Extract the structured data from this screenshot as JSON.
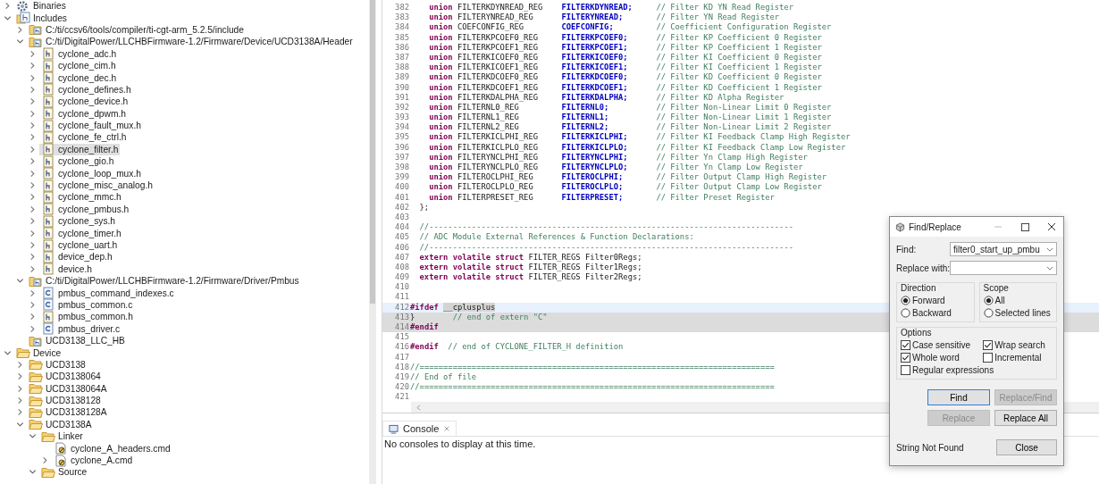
{
  "project_tree": [
    {
      "label": "Binaries",
      "kind": "binaries",
      "expanded": false,
      "selected": false
    },
    {
      "label": "Includes",
      "kind": "includes",
      "expanded": true,
      "selected": false,
      "children": [
        {
          "label": "C:/ti/ccsv6/tools/compiler/ti-cgt-arm_5.2.5/include",
          "kind": "include-folder",
          "expanded": false,
          "selected": false
        },
        {
          "label": "C:/ti/DigitalPower/LLCHBFirmware-1.2/Firmware/Device/UCD3138A/Header",
          "kind": "include-folder",
          "expanded": true,
          "selected": false,
          "children": [
            {
              "label": "cyclone_adc.h",
              "kind": "header",
              "expanded": false,
              "selected": false
            },
            {
              "label": "cyclone_cim.h",
              "kind": "header",
              "expanded": false,
              "selected": false
            },
            {
              "label": "cyclone_dec.h",
              "kind": "header",
              "expanded": false,
              "selected": false
            },
            {
              "label": "cyclone_defines.h",
              "kind": "header",
              "expanded": false,
              "selected": false
            },
            {
              "label": "cyclone_device.h",
              "kind": "header",
              "expanded": false,
              "selected": false
            },
            {
              "label": "cyclone_dpwm.h",
              "kind": "header",
              "expanded": false,
              "selected": false
            },
            {
              "label": "cyclone_fault_mux.h",
              "kind": "header",
              "expanded": false,
              "selected": false
            },
            {
              "label": "cyclone_fe_ctrl.h",
              "kind": "header",
              "expanded": false,
              "selected": false
            },
            {
              "label": "cyclone_filter.h",
              "kind": "header",
              "expanded": false,
              "selected": true
            },
            {
              "label": "cyclone_gio.h",
              "kind": "header",
              "expanded": false,
              "selected": false
            },
            {
              "label": "cyclone_loop_mux.h",
              "kind": "header",
              "expanded": false,
              "selected": false
            },
            {
              "label": "cyclone_misc_analog.h",
              "kind": "header",
              "expanded": false,
              "selected": false
            },
            {
              "label": "cyclone_mmc.h",
              "kind": "header",
              "expanded": false,
              "selected": false
            },
            {
              "label": "cyclone_pmbus.h",
              "kind": "header",
              "expanded": false,
              "selected": false
            },
            {
              "label": "cyclone_sys.h",
              "kind": "header",
              "expanded": false,
              "selected": false
            },
            {
              "label": "cyclone_timer.h",
              "kind": "header",
              "expanded": false,
              "selected": false
            },
            {
              "label": "cyclone_uart.h",
              "kind": "header",
              "expanded": false,
              "selected": false
            },
            {
              "label": "device_dep.h",
              "kind": "header",
              "expanded": false,
              "selected": false
            },
            {
              "label": "device.h",
              "kind": "header",
              "expanded": false,
              "selected": false
            }
          ]
        },
        {
          "label": "C:/ti/DigitalPower/LLCHBFirmware-1.2/Firmware/Driver/Pmbus",
          "kind": "include-folder",
          "expanded": true,
          "selected": false,
          "children": [
            {
              "label": "pmbus_command_indexes.c",
              "kind": "source",
              "expanded": false,
              "selected": false
            },
            {
              "label": "pmbus_common.c",
              "kind": "source",
              "expanded": false,
              "selected": false
            },
            {
              "label": "pmbus_common.h",
              "kind": "header",
              "expanded": false,
              "selected": false
            },
            {
              "label": "pmbus_driver.c",
              "kind": "source",
              "expanded": false,
              "selected": false
            }
          ]
        },
        {
          "label": "UCD3138_LLC_HB",
          "kind": "include-folder",
          "selected": false
        }
      ]
    },
    {
      "label": "Device",
      "kind": "folder",
      "expanded": true,
      "selected": false,
      "children": [
        {
          "label": "UCD3138",
          "kind": "folder",
          "expanded": false,
          "selected": false
        },
        {
          "label": "UCD3138064",
          "kind": "folder",
          "expanded": false,
          "selected": false
        },
        {
          "label": "UCD3138064A",
          "kind": "folder",
          "expanded": false,
          "selected": false
        },
        {
          "label": "UCD3138128",
          "kind": "folder",
          "expanded": false,
          "selected": false
        },
        {
          "label": "UCD3138128A",
          "kind": "folder",
          "expanded": false,
          "selected": false
        },
        {
          "label": "UCD3138A",
          "kind": "folder",
          "expanded": true,
          "selected": false,
          "children": [
            {
              "label": "Linker",
              "kind": "folder",
              "expanded": true,
              "selected": false,
              "children": [
                {
                  "label": "cyclone_A_headers.cmd",
                  "kind": "linker",
                  "selected": false
                },
                {
                  "label": "cyclone_A.cmd",
                  "kind": "linker",
                  "expanded": false,
                  "selected": false
                }
              ]
            },
            {
              "label": "Source",
              "kind": "folder",
              "expanded": true,
              "selected": false
            }
          ]
        }
      ]
    }
  ],
  "editor": {
    "lines": [
      {
        "number": "382",
        "kind": "member",
        "keyword": "union",
        "type": "FILTERKDYNREAD_REG",
        "name": "FILTERKDYNREAD;",
        "comment": "// Filter KD YN Read Register"
      },
      {
        "number": "383",
        "kind": "member",
        "keyword": "union",
        "type": "FILTERYNREAD_REG",
        "name": "FILTERYNREAD;",
        "comment": "// Filter YN Read Register"
      },
      {
        "number": "384",
        "kind": "member",
        "keyword": "union",
        "type": "COEFCONFIG_REG",
        "name": "COEFCONFIG;",
        "comment": "// Coefficient Configuration Register"
      },
      {
        "number": "385",
        "kind": "member",
        "keyword": "union",
        "type": "FILTERKPCOEF0_REG",
        "name": "FILTERKPCOEF0;",
        "comment": "// Filter KP Coefficient 0 Register"
      },
      {
        "number": "386",
        "kind": "member",
        "keyword": "union",
        "type": "FILTERKPCOEF1_REG",
        "name": "FILTERKPCOEF1;",
        "comment": "// Filter KP Coefficient 1 Register"
      },
      {
        "number": "387",
        "kind": "member",
        "keyword": "union",
        "type": "FILTERKICOEF0_REG",
        "name": "FILTERKICOEF0;",
        "comment": "// Filter KI Coefficient 0 Register"
      },
      {
        "number": "388",
        "kind": "member",
        "keyword": "union",
        "type": "FILTERKICOEF1_REG",
        "name": "FILTERKICOEF1;",
        "comment": "// Filter KI Coefficient 1 Register"
      },
      {
        "number": "389",
        "kind": "member",
        "keyword": "union",
        "type": "FILTERKDCOEF0_REG",
        "name": "FILTERKDCOEF0;",
        "comment": "// Filter KD Coefficient 0 Register"
      },
      {
        "number": "390",
        "kind": "member",
        "keyword": "union",
        "type": "FILTERKDCOEF1_REG",
        "name": "FILTERKDCOEF1;",
        "comment": "// Filter KD Coefficient 1 Register"
      },
      {
        "number": "391",
        "kind": "member",
        "keyword": "union",
        "type": "FILTERKDALPHA_REG",
        "name": "FILTERKDALPHA;",
        "comment": "// Filter KD Alpha Register"
      },
      {
        "number": "392",
        "kind": "member",
        "keyword": "union",
        "type": "FILTERNL0_REG",
        "name": "FILTERNL0;",
        "comment": "// Filter Non-Linear Limit 0 Register"
      },
      {
        "number": "393",
        "kind": "member",
        "keyword": "union",
        "type": "FILTERNL1_REG",
        "name": "FILTERNL1;",
        "comment": "// Filter Non-Linear Limit 1 Register"
      },
      {
        "number": "394",
        "kind": "member",
        "keyword": "union",
        "type": "FILTERNL2_REG",
        "name": "FILTERNL2;",
        "comment": "// Filter Non-Linear Limit 2 Register"
      },
      {
        "number": "395",
        "kind": "member",
        "keyword": "union",
        "type": "FILTERKICLPHI_REG",
        "name": "FILTERKICLPHI;",
        "comment": "// Filter KI Feedback Clamp High Register"
      },
      {
        "number": "396",
        "kind": "member",
        "keyword": "union",
        "type": "FILTERKICLPLO_REG",
        "name": "FILTERKICLPLO;",
        "comment": "// Filter KI Feedback Clamp Low Register"
      },
      {
        "number": "397",
        "kind": "member",
        "keyword": "union",
        "type": "FILTERYNCLPHI_REG",
        "name": "FILTERYNCLPHI;",
        "comment": "// Filter Yn Clamp High Register"
      },
      {
        "number": "398",
        "kind": "member",
        "keyword": "union",
        "type": "FILTERYNCLPLO_REG",
        "name": "FILTERYNCLPLO;",
        "comment": "// Filter Yn Clamp Low Register"
      },
      {
        "number": "399",
        "kind": "member",
        "keyword": "union",
        "type": "FILTEROCLPHI_REG",
        "name": "FILTEROCLPHI;",
        "comment": "// Filter Output Clamp High Register"
      },
      {
        "number": "400",
        "kind": "member",
        "keyword": "union",
        "type": "FILTEROCLPLO_REG",
        "name": "FILTEROCLPLO;",
        "comment": "// Filter Output Clamp Low Register"
      },
      {
        "number": "401",
        "kind": "member",
        "keyword": "union",
        "type": "FILTERPRESET_REG",
        "name": "FILTERPRESET;",
        "comment": "// Filter Preset Register"
      },
      {
        "number": "402",
        "kind": "body",
        "segments": [
          {
            "kind": "plain",
            "text": "};"
          }
        ]
      },
      {
        "number": "403",
        "kind": "body"
      },
      {
        "number": "404",
        "kind": "body",
        "segments": [
          {
            "kind": "comment",
            "text": "//-----------------------------------------------------------------------------"
          }
        ]
      },
      {
        "number": "405",
        "kind": "body",
        "segments": [
          {
            "kind": "comment",
            "text": "// ADC Module External References & Function Declarations:"
          }
        ]
      },
      {
        "number": "406",
        "kind": "body",
        "segments": [
          {
            "kind": "comment",
            "text": "//-----------------------------------------------------------------------------"
          }
        ]
      },
      {
        "number": "407",
        "kind": "body",
        "segments": [
          {
            "kind": "keyword",
            "text": "extern volatile struct"
          },
          {
            "kind": "plain",
            "text": " FILTER_REGS Filter0Regs;"
          }
        ]
      },
      {
        "number": "408",
        "kind": "body",
        "segments": [
          {
            "kind": "keyword",
            "text": "extern volatile struct"
          },
          {
            "kind": "plain",
            "text": " FILTER_REGS Filter1Regs;"
          }
        ]
      },
      {
        "number": "409",
        "kind": "body",
        "segments": [
          {
            "kind": "keyword",
            "text": "extern volatile struct"
          },
          {
            "kind": "plain",
            "text": " FILTER_REGS Filter2Regs;"
          }
        ]
      },
      {
        "number": "410",
        "kind": "body"
      },
      {
        "number": "411",
        "kind": "body"
      },
      {
        "number": "412",
        "kind": "top",
        "current": true,
        "segments": [
          {
            "kind": "keyword",
            "text": "#ifdef "
          },
          {
            "kind": "marked",
            "text": "__cplusplus"
          }
        ]
      },
      {
        "number": "413",
        "kind": "top",
        "highlighted": true,
        "segments": [
          {
            "kind": "plain",
            "text": "}        "
          },
          {
            "kind": "comment",
            "text": "// end of extern \"C\""
          }
        ]
      },
      {
        "number": "414",
        "kind": "top",
        "highlighted": true,
        "segments": [
          {
            "kind": "keyword",
            "text": "#endif"
          }
        ]
      },
      {
        "number": "415",
        "kind": "top"
      },
      {
        "number": "416",
        "kind": "top",
        "segments": [
          {
            "kind": "keyword",
            "text": "#endif"
          },
          {
            "kind": "comment",
            "text": "  // end of CYCLONE_FILTER_H definition"
          }
        ]
      },
      {
        "number": "417",
        "kind": "top"
      },
      {
        "number": "418",
        "kind": "top",
        "segments": [
          {
            "kind": "comment",
            "text": "//==========================================================================="
          }
        ]
      },
      {
        "number": "419",
        "kind": "top",
        "segments": [
          {
            "kind": "comment",
            "text": "// End of file"
          }
        ]
      },
      {
        "number": "420",
        "kind": "top",
        "segments": [
          {
            "kind": "comment",
            "text": "//==========================================================================="
          }
        ]
      },
      {
        "number": "421",
        "kind": "top"
      }
    ]
  },
  "console": {
    "tab": "Console",
    "message": "No consoles to display at this time."
  },
  "find_replace_dialog": {
    "title": "Find/Replace",
    "find_label": "Find:",
    "find_value": "filter0_start_up_pmbu",
    "replace_label": "Replace with:",
    "direction": {
      "title": "Direction",
      "options": [
        {
          "label": "Forward",
          "selected": true
        },
        {
          "label": "Backward",
          "selected": false
        }
      ]
    },
    "scope": {
      "title": "Scope",
      "options": [
        {
          "label": "All",
          "selected": true
        },
        {
          "label": "Selected lines",
          "selected": false
        }
      ]
    },
    "options": {
      "title": "Options",
      "items": [
        {
          "label": "Case sensitive",
          "checked": true
        },
        {
          "label": "Wrap search",
          "checked": true
        },
        {
          "label": "Whole word",
          "checked": true
        },
        {
          "label": "Incremental",
          "checked": false
        },
        {
          "label": "Regular expressions",
          "checked": false
        }
      ]
    },
    "buttons": [
      {
        "label": "Find",
        "disabled": false,
        "default": true
      },
      {
        "label": "Replace/Find",
        "disabled": true,
        "default": false
      },
      {
        "label": "Replace",
        "disabled": true,
        "default": false
      },
      {
        "label": "Replace All",
        "disabled": false,
        "default": false
      }
    ],
    "status": "String Not Found",
    "close_button": "Close"
  }
}
